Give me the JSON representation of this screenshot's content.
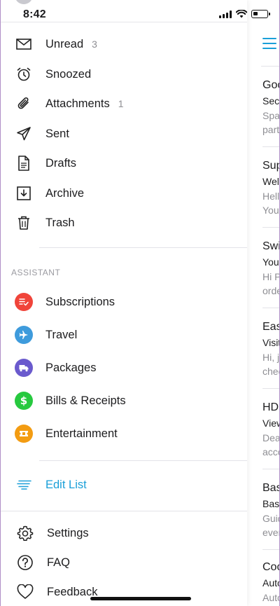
{
  "status_bar": {
    "time": "8:42"
  },
  "drawer": {
    "folders": [
      {
        "label": "Unread",
        "count": "3",
        "icon": "envelope-icon"
      },
      {
        "label": "Snoozed",
        "count": "",
        "icon": "alarm-clock-icon"
      },
      {
        "label": "Attachments",
        "count": "1",
        "icon": "paperclip-icon"
      },
      {
        "label": "Sent",
        "count": "",
        "icon": "paper-plane-icon"
      },
      {
        "label": "Drafts",
        "count": "",
        "icon": "document-icon"
      },
      {
        "label": "Archive",
        "count": "",
        "icon": "archive-box-icon"
      },
      {
        "label": "Trash",
        "count": "",
        "icon": "trash-icon"
      }
    ],
    "assistant_label": "ASSISTANT",
    "assistant_items": [
      {
        "label": "Subscriptions",
        "icon": "subscriptions-icon",
        "color": "#f0443a"
      },
      {
        "label": "Travel",
        "icon": "airplane-icon",
        "color": "#3e9bdc"
      },
      {
        "label": "Packages",
        "icon": "truck-icon",
        "color": "#6a5acd"
      },
      {
        "label": "Bills & Receipts",
        "icon": "dollar-icon",
        "color": "#27c93f"
      },
      {
        "label": "Entertainment",
        "icon": "ticket-icon",
        "color": "#f39c12"
      }
    ],
    "edit_list_label": "Edit List",
    "footer_items": [
      {
        "label": "Settings",
        "icon": "gear-icon"
      },
      {
        "label": "FAQ",
        "icon": "question-circle-icon"
      },
      {
        "label": "Feedback",
        "icon": "heart-icon"
      }
    ]
  },
  "inbox_preview": {
    "messages": [
      {
        "sender": "Goo",
        "subject": "Sec",
        "preview1": "Spa",
        "preview2": "part"
      },
      {
        "sender": "Sup",
        "subject": "Welc",
        "preview1": "Hell",
        "preview2": "You"
      },
      {
        "sender": "Swi",
        "subject": "Your",
        "preview1": "Hi P",
        "preview2": "orde"
      },
      {
        "sender": "Eas",
        "subject": "Visit",
        "preview1": "Hi, j",
        "preview2": "chec"
      },
      {
        "sender": "HDI",
        "subject": "View",
        "preview1": "Dea",
        "preview2": "acco"
      },
      {
        "sender": "Bas",
        "subject": "Basi",
        "preview1": "Guid",
        "preview2": "ever"
      },
      {
        "sender": "Coo",
        "subject": "Auto",
        "preview1": "Auto",
        "preview2": ""
      }
    ]
  },
  "colors": {
    "accent": "#1a9fd8"
  }
}
